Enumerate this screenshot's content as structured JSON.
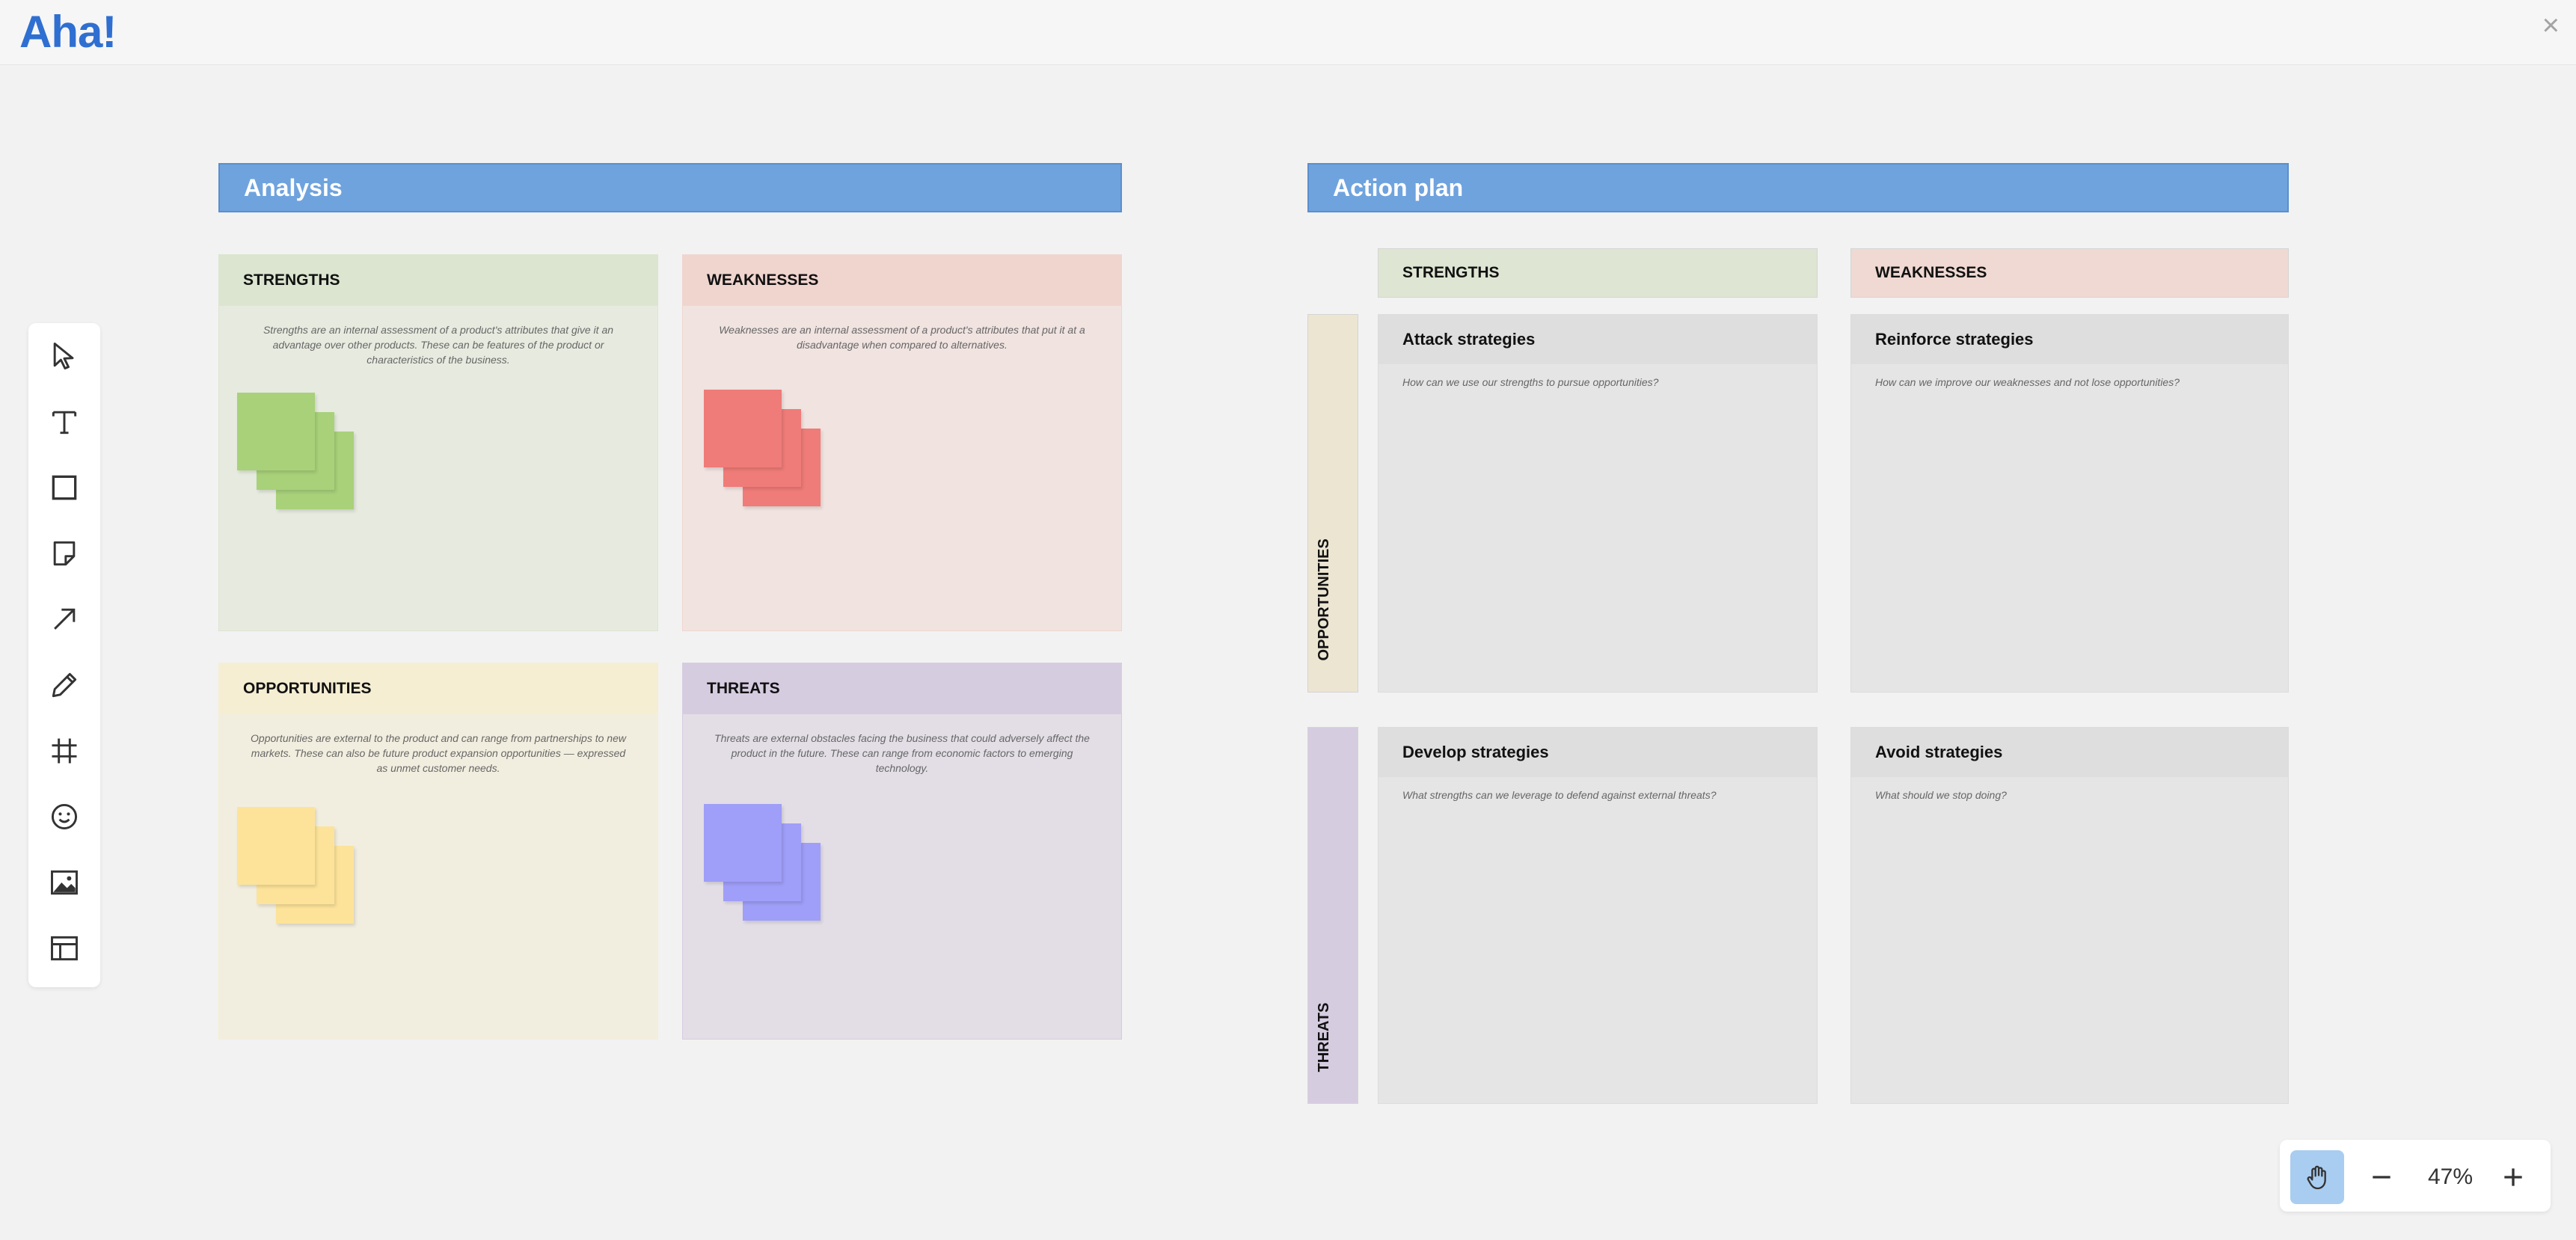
{
  "app": {
    "logo": "Aha!",
    "close_glyph": "×"
  },
  "toolbar": {
    "tools": [
      {
        "name": "select-tool",
        "icon": "cursor-arrow-icon"
      },
      {
        "name": "text-tool",
        "icon": "text-icon"
      },
      {
        "name": "shape-tool",
        "icon": "square-icon"
      },
      {
        "name": "sticky-note-tool",
        "icon": "sticky-note-icon"
      },
      {
        "name": "arrow-tool",
        "icon": "arrow-icon"
      },
      {
        "name": "pen-tool",
        "icon": "pencil-icon"
      },
      {
        "name": "frame-tool",
        "icon": "frame-icon"
      },
      {
        "name": "emoji-tool",
        "icon": "smiley-icon"
      },
      {
        "name": "image-tool",
        "icon": "image-icon"
      },
      {
        "name": "template-tool",
        "icon": "template-icon"
      }
    ]
  },
  "analysis": {
    "title": "Analysis",
    "quadrants": [
      {
        "title": "STRENGTHS",
        "description": "Strengths are an internal assessment of a product's attributes that give it an advantage over other products. These can be features of the product or characteristics of the business.",
        "bg": "#e7ebdf",
        "head_bg": "#dbe5d0",
        "note_color": "#a8d17a"
      },
      {
        "title": "WEAKNESSES",
        "description": "Weaknesses are an internal assessment of a product's attributes that put it at a disadvantage when compared to alternatives.",
        "bg": "#f0e3e0",
        "head_bg": "#f0d5cf",
        "note_color": "#ef7c78"
      },
      {
        "title": "OPPORTUNITIES",
        "description": "Opportunities are external to the product and can range from partnerships to new markets. These can also be future product expansion opportunities — expressed as unmet customer needs.",
        "bg": "#f2eedf",
        "head_bg": "#f5eed3",
        "note_color": "#fde39a"
      },
      {
        "title": "THREATS",
        "description": "Threats are external obstacles facing the business that could adversely affect the product in the future. These can range from economic factors to emerging technology.",
        "bg": "#e3dee6",
        "head_bg": "#d6cce0",
        "note_color": "#9f9ef8"
      }
    ]
  },
  "action_plan": {
    "title": "Action plan",
    "columns": [
      {
        "title": "STRENGTHS",
        "bg": "#dee6d3"
      },
      {
        "title": "WEAKNESSES",
        "bg": "#f0d9d3"
      }
    ],
    "rows": [
      {
        "title": "OPPORTUNITIES",
        "bg": "#ece5d2"
      },
      {
        "title": "THREATS",
        "bg": "#d6cce0"
      }
    ],
    "cells": [
      {
        "title": "Attack strategies",
        "description": "How can we use our strengths to pursue opportunities?"
      },
      {
        "title": "Reinforce strategies",
        "description": "How can we improve our weaknesses and not lose opportunities?"
      },
      {
        "title": "Develop strategies",
        "description": "What strengths can we leverage to defend against external threats?"
      },
      {
        "title": "Avoid strategies",
        "description": "What should we stop doing?"
      }
    ]
  },
  "zoom": {
    "level": "47%",
    "pan_active": true,
    "accent": "#a9cdf0"
  }
}
